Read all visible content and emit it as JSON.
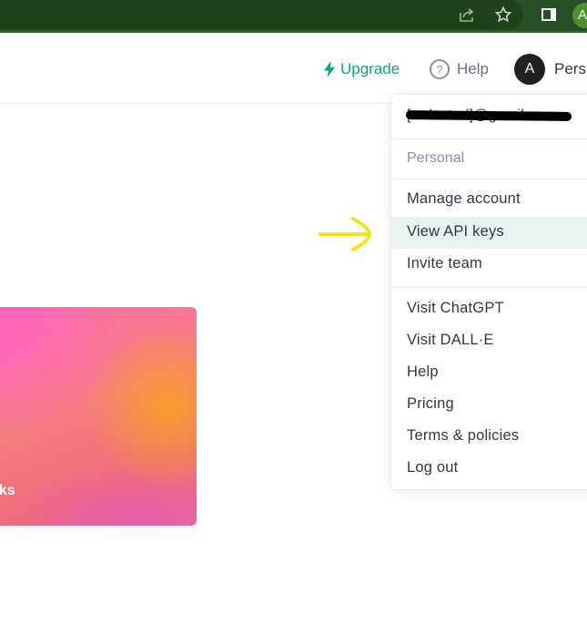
{
  "browser": {
    "icons": [
      "share-icon",
      "bookmark-star-icon",
      "side-panel-icon"
    ],
    "profile_initial": "A"
  },
  "topnav": {
    "upgrade_label": "Upgrade",
    "help_label": "Help",
    "avatar_initial": "A",
    "account_label": "Pers",
    "accent_color": "#10a37f"
  },
  "dropdown": {
    "email": "[redacted]@gmail.com",
    "section_label": "Personal",
    "group1": [
      {
        "label": "Manage account"
      },
      {
        "label": "View API keys",
        "highlighted": true
      },
      {
        "label": "Invite team"
      }
    ],
    "group2": [
      {
        "label": "Visit ChatGPT"
      },
      {
        "label": "Visit DALL·E"
      },
      {
        "label": "Help"
      },
      {
        "label": "Pricing"
      },
      {
        "label": "Terms & policies"
      },
      {
        "label": "Log out"
      }
    ]
  },
  "annotation": {
    "arrow_color": "#f5e21b",
    "points_to": "View API keys"
  },
  "hero_card": {
    "title_visible_fragment": "sks"
  }
}
